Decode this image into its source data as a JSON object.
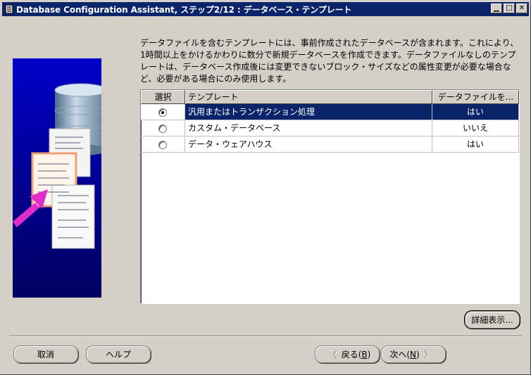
{
  "window": {
    "title": "Database Configuration Assistant, ステップ2/12 : データベース・テンプレート",
    "minimize_glyph": "▁",
    "maximize_glyph": "□",
    "close_glyph": "✕"
  },
  "description": "データファイルを含むテンプレートには、事前作成されたデータベースが含まれます。これにより、1時間以上をかけるかわりに数分で新規データベースを作成できます。データファイルなしのテンプレートは、データベース作成後には変更できないブロック・サイズなどの属性変更が必要な場合など、必要がある場合にのみ使用します。",
  "table": {
    "headers": [
      "選択",
      "テンプレート",
      "データファイルを..."
    ],
    "rows": [
      {
        "template": "汎用またはトランザクション処理",
        "datafiles": "はい",
        "selected": true
      },
      {
        "template": "カスタム・データベース",
        "datafiles": "いいえ",
        "selected": false
      },
      {
        "template": "データ・ウェアハウス",
        "datafiles": "はい",
        "selected": false
      }
    ]
  },
  "buttons": {
    "details": "詳細表示...",
    "cancel": "取消",
    "help": "ヘルプ",
    "back_label": "戻る(",
    "back_mnemonic": "B",
    "back_close": ")",
    "next_label": "次へ(",
    "next_mnemonic": "N",
    "next_close": ")"
  },
  "colors": {
    "titlebar": "#0a246a",
    "selection": "#0a246a",
    "face": "#d4d0c8",
    "image_background": "#0000a0",
    "arrow": "#e02ccb"
  },
  "icons": {
    "title_icon": "database-app-icon",
    "back_icon": "chevron-left-icon",
    "next_icon": "chevron-right-icon"
  }
}
